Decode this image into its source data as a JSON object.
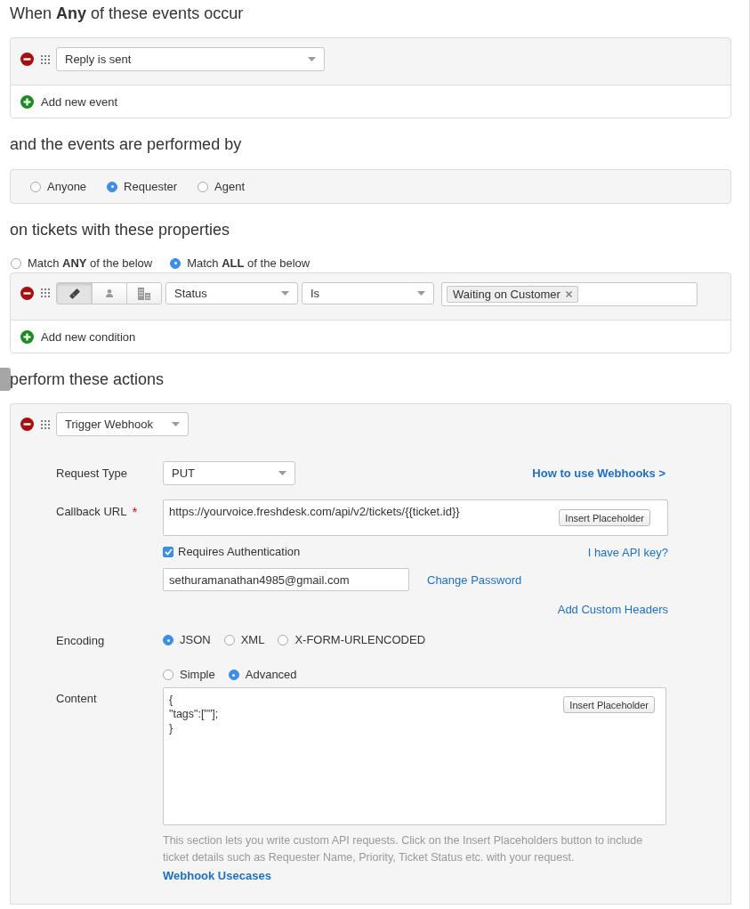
{
  "events_section": {
    "heading": "When **Any** of these events occur",
    "events": [
      {
        "value": "Reply is sent"
      }
    ],
    "add_label": "Add new event"
  },
  "performer_section": {
    "heading": "and the events are performed by",
    "options": [
      {
        "label": "Anyone",
        "selected": false
      },
      {
        "label": "Requester",
        "selected": true
      },
      {
        "label": "Agent",
        "selected": false
      }
    ]
  },
  "conditions_section": {
    "heading": "on tickets with these properties",
    "match_options": [
      {
        "label": "Match **ANY** of the below",
        "selected": false
      },
      {
        "label": "Match **ALL** of the below",
        "selected": true
      }
    ],
    "conditions": [
      {
        "scopes": [
          {
            "kind": "ticket",
            "selected": true
          },
          {
            "kind": "contact",
            "selected": false
          },
          {
            "kind": "company",
            "selected": false
          }
        ],
        "field": "Status",
        "operator": "Is",
        "values": [
          "Waiting on Customer"
        ]
      }
    ],
    "add_label": "Add new condition"
  },
  "actions_section": {
    "heading": "perform these actions",
    "actions": [
      {
        "type": "Trigger Webhook",
        "request_type": {
          "label": "Request Type",
          "value": "PUT"
        },
        "help_link": "How to use Webhooks >",
        "callback_url": {
          "label": "Callback URL",
          "required_mark": "*",
          "value": "https://yourvoice.freshdesk.com/api/v2/tickets/{{ticket.id}}",
          "insert_button": "Insert Placeholder"
        },
        "authentication": {
          "label": "Requires Authentication",
          "checked": true,
          "api_key_link": "I have API key?",
          "username": "sethuramanathan4985@gmail.com",
          "change_password_link": "Change Password"
        },
        "custom_headers_link": "Add Custom Headers",
        "encoding": {
          "label": "Encoding",
          "options": [
            {
              "label": "JSON",
              "selected": true
            },
            {
              "label": "XML",
              "selected": false
            },
            {
              "label": "X-FORM-URLENCODED",
              "selected": false
            }
          ]
        },
        "content": {
          "label": "Content",
          "modes": [
            {
              "label": "Simple",
              "selected": false
            },
            {
              "label": "Advanced",
              "selected": true
            }
          ],
          "value": "{\n\"tags\":[\"\"];\n}",
          "insert_button": "Insert Placeholder",
          "help": "This section lets you write custom API requests. Click on the Insert Placeholders button to include ticket details such as Requester Name, Priority, Ticket Status etc. with your request.",
          "usecases_link": "Webhook Usecases"
        }
      }
    ]
  }
}
